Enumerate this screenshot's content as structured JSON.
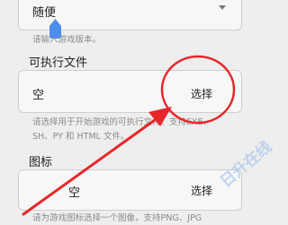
{
  "version_field": {
    "value": "随便",
    "hint": "请输入游戏版本。"
  },
  "executable": {
    "title": "可执行文件",
    "value": "空",
    "select_label": "选择",
    "hint_line1": "请选择用于开始游戏的可执行文件。支持EXE、",
    "hint_line2": "SH、PY 和 HTML 文件。"
  },
  "icon_section": {
    "title": "图标",
    "value": "空",
    "select_label": "选择",
    "hint": "请为游戏图标选择一个图像，支持PNG、JPG"
  },
  "watermark": "日升在线",
  "annotation": {
    "circle_color": "#e8262a",
    "arrow_color": "#e8262a"
  },
  "colors": {
    "accent": "#4b8ef0"
  }
}
